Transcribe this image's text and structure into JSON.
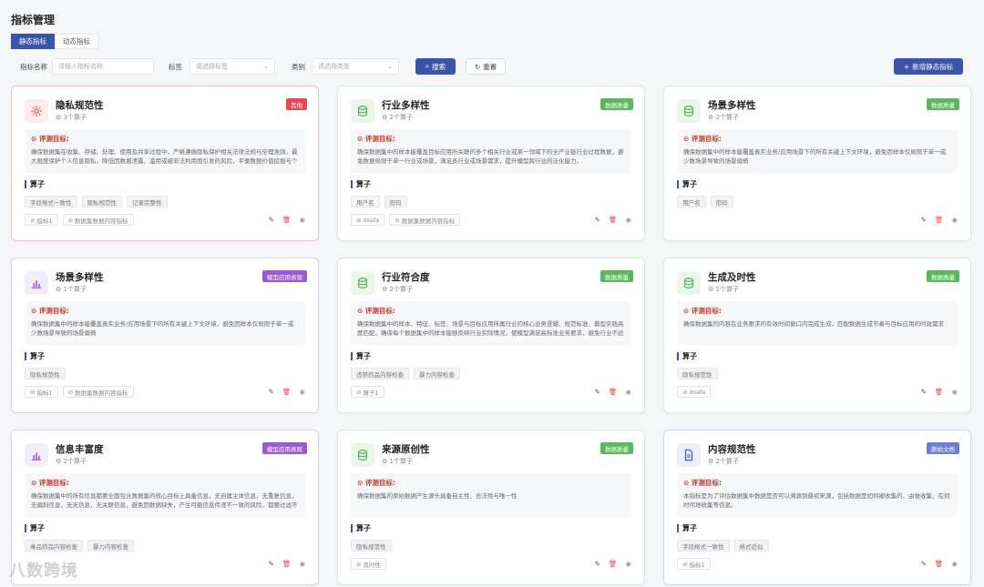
{
  "page": {
    "title": "指标管理"
  },
  "tabs": [
    {
      "label": "静态指标",
      "active": true
    },
    {
      "label": "动态指标",
      "active": false
    }
  ],
  "filters": {
    "name_label": "指标名称",
    "name_placeholder": "请输入指标名称",
    "tag_label": "标签",
    "tag_placeholder": "请选择标签",
    "category_label": "类别",
    "category_placeholder": "请选择类型",
    "search_label": "搜索",
    "reset_label": "重置",
    "add_label": "新增静态指标"
  },
  "colors": {
    "primary": "#3a55a8",
    "green_tag": "#5cb85c",
    "red_tag": "#e5484d",
    "purple_tag": "#9b59d0",
    "blue_tag": "#6a7fd1"
  },
  "cards": [
    {
      "title": "隐私规范性",
      "count": "3个算子",
      "tag": "其他",
      "icon": "gear-icon",
      "goal_label": "评测目标:",
      "goal": "确保数据集在收集、存储、处理、使用及共享过程中，严格遵循隐私保护相关法律法规与伦理准则，最大限度保护个人信息隐私，降低因数据泄露、滥用或被非法利用而引发的风险，平衡数据价值挖掘与个人隐私权益。",
      "section": "算子",
      "chips": [
        "字段格式一致性",
        "隐私规范性",
        "记录完整性"
      ],
      "tags": [
        "指标1",
        "数据集数据内容指标"
      ]
    },
    {
      "title": "行业多样性",
      "count": "2个算子",
      "tag": "数据质量",
      "icon": "database-icon",
      "goal_label": "评测目标:",
      "goal": "确保数据集中的样本能覆盖目标应用所关联的多个相关行业或某一领域下的全产业链行业过程数据，避免数据局限于单一行业或场景，满足多行业或场景需求，提升模型跨行业的泛化能力。",
      "section": "算子",
      "chips": [
        "用户名",
        "密码"
      ],
      "tags": [
        "dsafa",
        "数据集数据内容指标"
      ]
    },
    {
      "title": "场景多样性",
      "count": "2个算子",
      "tag": "数据质量",
      "icon": "database-icon",
      "goal_label": "评测目标:",
      "goal": "确保数据集中的样本能覆盖真实业务/应用场景下的所有关键上下文环境，避免因样本仅局限于单一或少数场景导致的场景偏倚",
      "section": "算子",
      "chips": [
        "用户名",
        "密码"
      ],
      "tags": []
    },
    {
      "title": "场景多样性",
      "count": "1个算子",
      "tag": "模型应用表现",
      "icon": "chart-icon",
      "goal_label": "评测目标:",
      "goal": "确保数据集中的样本能覆盖真实业务/应用场景下的所有关键上下文环境，避免因样本仅局限于单一或少数场景导致的场景偏倚",
      "section": "算子",
      "chips": [
        "隐私规范性"
      ],
      "tags": [
        "指标1",
        "数据集数据内容指标"
      ]
    },
    {
      "title": "行业符合度",
      "count": "2个算子",
      "tag": "数据质量",
      "icon": "database-icon",
      "goal_label": "评测目标:",
      "goal": "确保数据集中的样本、特征、标签、场景与目标应用所属行业的核心业务逻辑、规范标准、典型实践高度匹配，确保每个数据集中的样本能够反映行业实际情况，使模型满足高标准业务要求，避免行业不适配。",
      "section": "算子",
      "chips": [
        "违禁药品内容检查",
        "暴力内容检查"
      ],
      "tags": [
        "算子1"
      ]
    },
    {
      "title": "生成及时性",
      "count": "1个算子",
      "tag": "数据质量",
      "icon": "database-icon",
      "goal_label": "评测目标:",
      "goal": "确保数据集的内容在业务要求的有效时间窗口内完成生成，匹配数据生成节奏与目标应用的时效需求",
      "section": "算子",
      "chips": [
        "隐私规范性"
      ],
      "tags": [
        "dsafa"
      ]
    },
    {
      "title": "信息丰富度",
      "count": "2个算子",
      "tag": "模型应用表现",
      "icon": "chart-icon",
      "goal_label": "评测目标:",
      "goal": "确保数据集中的所有信息都要全面包含数据集的核心目标上具备信息，无自属主体信息，无重复信息，无偏斜信息，无无信息，无关联信息，避免因数据缺失，产生可能信息传递不一致的风险，都要过滤不相干信息等。",
      "section": "算子",
      "chips": [
        "毒品药品内容检查",
        "暴力内容检查"
      ],
      "tags": []
    },
    {
      "title": "来源原创性",
      "count": "1个算子",
      "tag": "数据质量",
      "icon": "database-icon",
      "goal_label": "评测目标:",
      "goal": "确保数据集的原始数据产生源头具备自主性、合法性与唯一性",
      "section": "算子",
      "chips": [
        "隐私规范性"
      ],
      "tags": [
        "及时性"
      ]
    },
    {
      "title": "内容规范性",
      "count": "2个算子",
      "tag": "原始文档",
      "icon": "document-icon",
      "goal_label": "评测目标:",
      "goal": "本指标是为了评估数据集中数据是否可以溯源到最初来源，包括数据是如何被收集的、由谁收集、在何时何地收集等信息。",
      "section": "算子",
      "chips": [
        "字段格式一致性",
        "格式近似"
      ],
      "tags": [
        "指标1"
      ]
    }
  ],
  "watermark": "八数跨境"
}
